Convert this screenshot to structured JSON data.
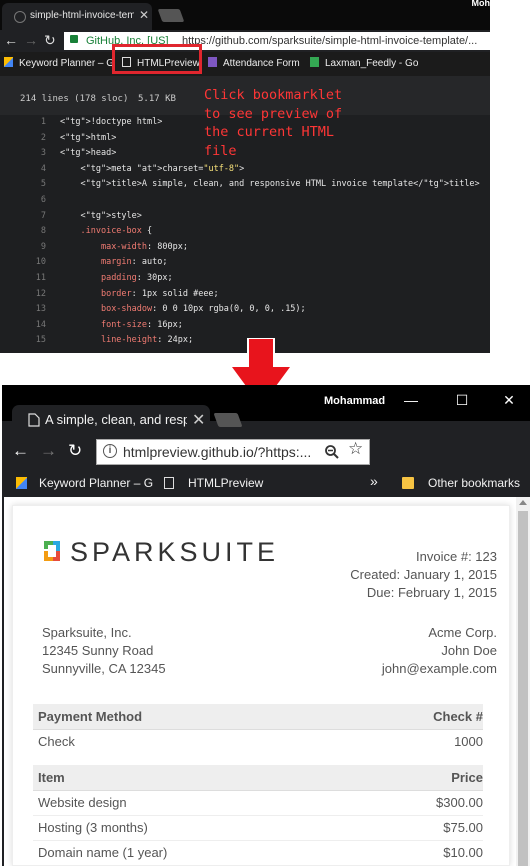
{
  "top": {
    "tab_title": "simple-html-invoice-temp",
    "user": "Moh",
    "url_org": "GitHub, Inc. [US]",
    "url": "https://github.com/sparksuite/simple-html-invoice-template/...",
    "bookmarks": [
      "Keyword Planner – G",
      "HTMLPreview",
      "Attendance Form",
      "Laxman_Feedly - Go"
    ],
    "file_lines": "214 lines (178 sloc)",
    "file_size": "5.17 KB",
    "annotation": "Click bookmarklet to see preview of the current HTML file",
    "code_lines": [
      {
        "n": "1",
        "t": "<!doctype html>"
      },
      {
        "n": "2",
        "t": "<html>"
      },
      {
        "n": "3",
        "t": "<head>"
      },
      {
        "n": "4",
        "t": "    <meta charset=\"utf-8\">"
      },
      {
        "n": "5",
        "t": "    <title>A simple, clean, and responsive HTML invoice template</title>"
      },
      {
        "n": "6",
        "t": ""
      },
      {
        "n": "7",
        "t": "    <style>"
      },
      {
        "n": "8",
        "t": "    .invoice-box {"
      },
      {
        "n": "9",
        "t": "        max-width: 800px;"
      },
      {
        "n": "10",
        "t": "        margin: auto;"
      },
      {
        "n": "11",
        "t": "        padding: 30px;"
      },
      {
        "n": "12",
        "t": "        border: 1px solid #eee;"
      },
      {
        "n": "13",
        "t": "        box-shadow: 0 0 10px rgba(0, 0, 0, .15);"
      },
      {
        "n": "14",
        "t": "        font-size: 16px;"
      },
      {
        "n": "15",
        "t": "        line-height: 24px;"
      }
    ]
  },
  "bottom": {
    "tab_title": "A simple, clean, and respo",
    "user": "Mohammad",
    "url": "htmlpreview.github.io/?https:...",
    "bookmarks": [
      "Keyword Planner – G",
      "HTMLPreview"
    ],
    "overflow": "»",
    "other_bookmarks": "Other bookmarks"
  },
  "invoice": {
    "logo_text": "SPARKSUITE",
    "number": "Invoice #: 123",
    "created": "Created: January 1, 2015",
    "due": "Due: February 1, 2015",
    "from": [
      "Sparksuite, Inc.",
      "12345 Sunny Road",
      "Sunnyville, CA 12345"
    ],
    "to": [
      "Acme Corp.",
      "John Doe",
      "john@example.com"
    ],
    "payment_header": {
      "l": "Payment Method",
      "r": "Check #"
    },
    "payment_row": {
      "l": "Check",
      "r": "1000"
    },
    "items_header": {
      "l": "Item",
      "r": "Price"
    },
    "items": [
      {
        "l": "Website design",
        "r": "$300.00"
      },
      {
        "l": "Hosting (3 months)",
        "r": "$75.00"
      },
      {
        "l": "Domain name (1 year)",
        "r": "$10.00"
      }
    ]
  },
  "colors": {
    "highlight": "#e0262e",
    "annotation": "#ff3636",
    "arrow": "#e8141c"
  }
}
